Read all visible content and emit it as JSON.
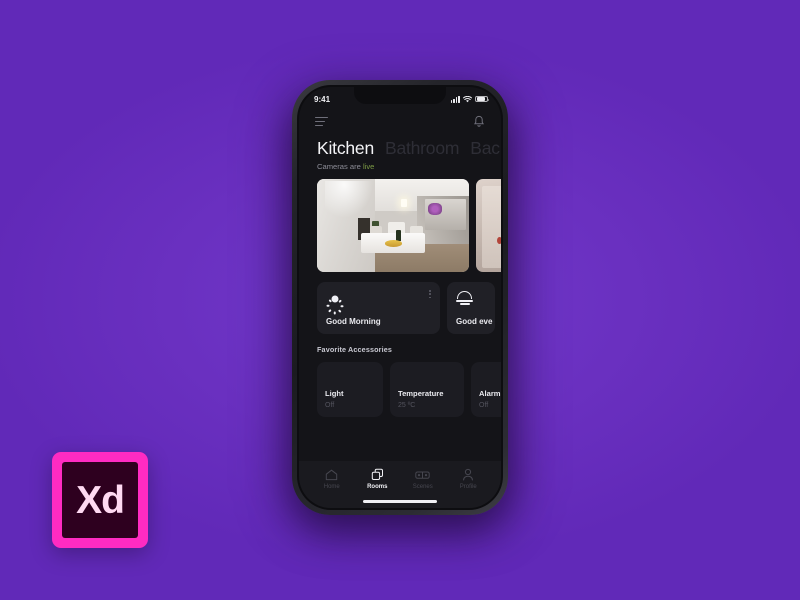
{
  "canvas": {
    "background_color": "#6a30c0"
  },
  "branding": {
    "badge_name": "adobe-xd-logo",
    "badge_text": "Xd",
    "badge_border_color": "#ff2bc2",
    "badge_fill_color": "#2e001f",
    "badge_text_color": "#ffd9f2"
  },
  "phone": {
    "status_bar": {
      "time": "9:41",
      "signal_icon": "cellular-signal-icon",
      "wifi_icon": "wifi-icon",
      "battery_icon": "battery-icon"
    },
    "app_bar": {
      "menu_icon": "hamburger-menu-icon",
      "notifications_icon": "bell-icon"
    },
    "room_tabs": [
      {
        "label": "Kitchen",
        "active": true
      },
      {
        "label": "Bathroom",
        "active": false
      },
      {
        "label": "Bac",
        "active": false
      }
    ],
    "cameras_status": {
      "prefix": "Cameras are ",
      "state": "live",
      "state_color": "#7d9b45"
    },
    "camera_feeds": [
      {
        "name": "kitchen-camera-feed"
      },
      {
        "name": "hallway-camera-feed"
      }
    ],
    "scenes": [
      {
        "label": "Good Morning",
        "icon": "sun-icon",
        "menu_icon": "more-vertical-icon"
      },
      {
        "label": "Good eve",
        "icon": "sunset-icon"
      }
    ],
    "favorites": {
      "title": "Favorite Accessories",
      "items": [
        {
          "name": "Light",
          "state": "Off"
        },
        {
          "name": "Temperature",
          "state": "25 ºC"
        },
        {
          "name": "Alarm",
          "state": "Off"
        }
      ]
    },
    "tabbar": [
      {
        "label": "Home",
        "icon": "home-icon",
        "active": false
      },
      {
        "label": "Rooms",
        "icon": "rooms-icon",
        "active": true
      },
      {
        "label": "Scenes",
        "icon": "scenes-icon",
        "active": false
      },
      {
        "label": "Profile",
        "icon": "profile-icon",
        "active": false
      }
    ]
  }
}
